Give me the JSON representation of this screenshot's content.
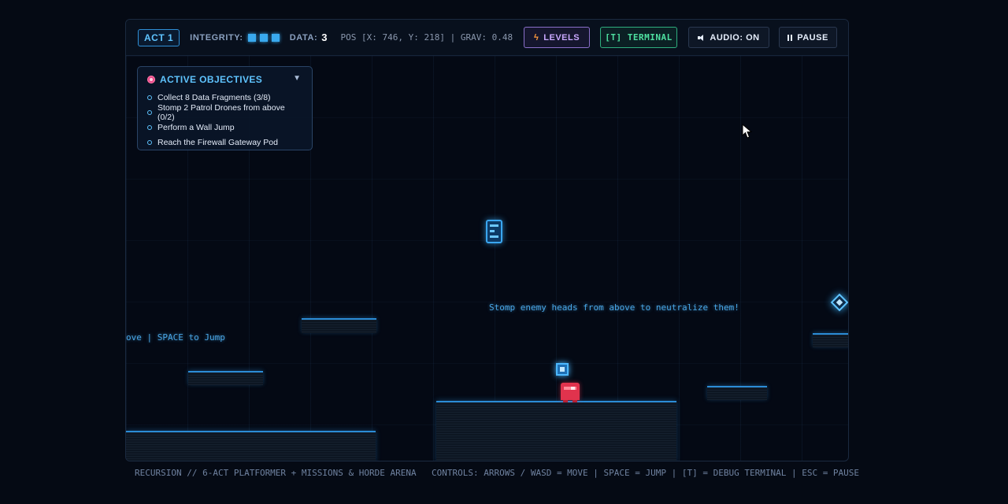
{
  "hud": {
    "act": "ACT 1",
    "integrity_label": "INTEGRITY:",
    "integrity_pips": 3,
    "data_label": "DATA:",
    "data_value": "3",
    "pos_text": "POS [X: 746, Y: 218] | GRAV: 0.48",
    "levels_label": "LEVELS",
    "levels_icon": "lightning-bolt",
    "terminal_label": "[T] TERMINAL",
    "audio_label": "AUDIO: ON",
    "audio_icon": "speaker",
    "pause_label": "PAUSE",
    "pause_icon": "pause"
  },
  "objectives": {
    "title": "ACTIVE OBJECTIVES",
    "icon": "target",
    "items": [
      "Collect 8 Data Fragments (3/8)",
      "Stomp 2 Patrol Drones from above (0/2)",
      "Perform a Wall Jump",
      "Reach the Firewall Gateway Pod"
    ]
  },
  "world": {
    "hint_left": "ove | SPACE to Jump",
    "hint_center": "Stomp enemy heads from above to neutralize them!"
  },
  "footer": {
    "left": "RECURSION // 6-ACT PLATFORMER + MISSIONS & HORDE ARENA",
    "right": "CONTROLS: ARROWS / WASD = MOVE | SPACE = JUMP | [T] = DEBUG TERMINAL | ESC = PAUSE"
  },
  "colors": {
    "accent": "#39a9ee",
    "player": "#e0334d",
    "terminal": "#4ee0a0",
    "levels": "#c9a8ff",
    "background": "#050a14"
  }
}
